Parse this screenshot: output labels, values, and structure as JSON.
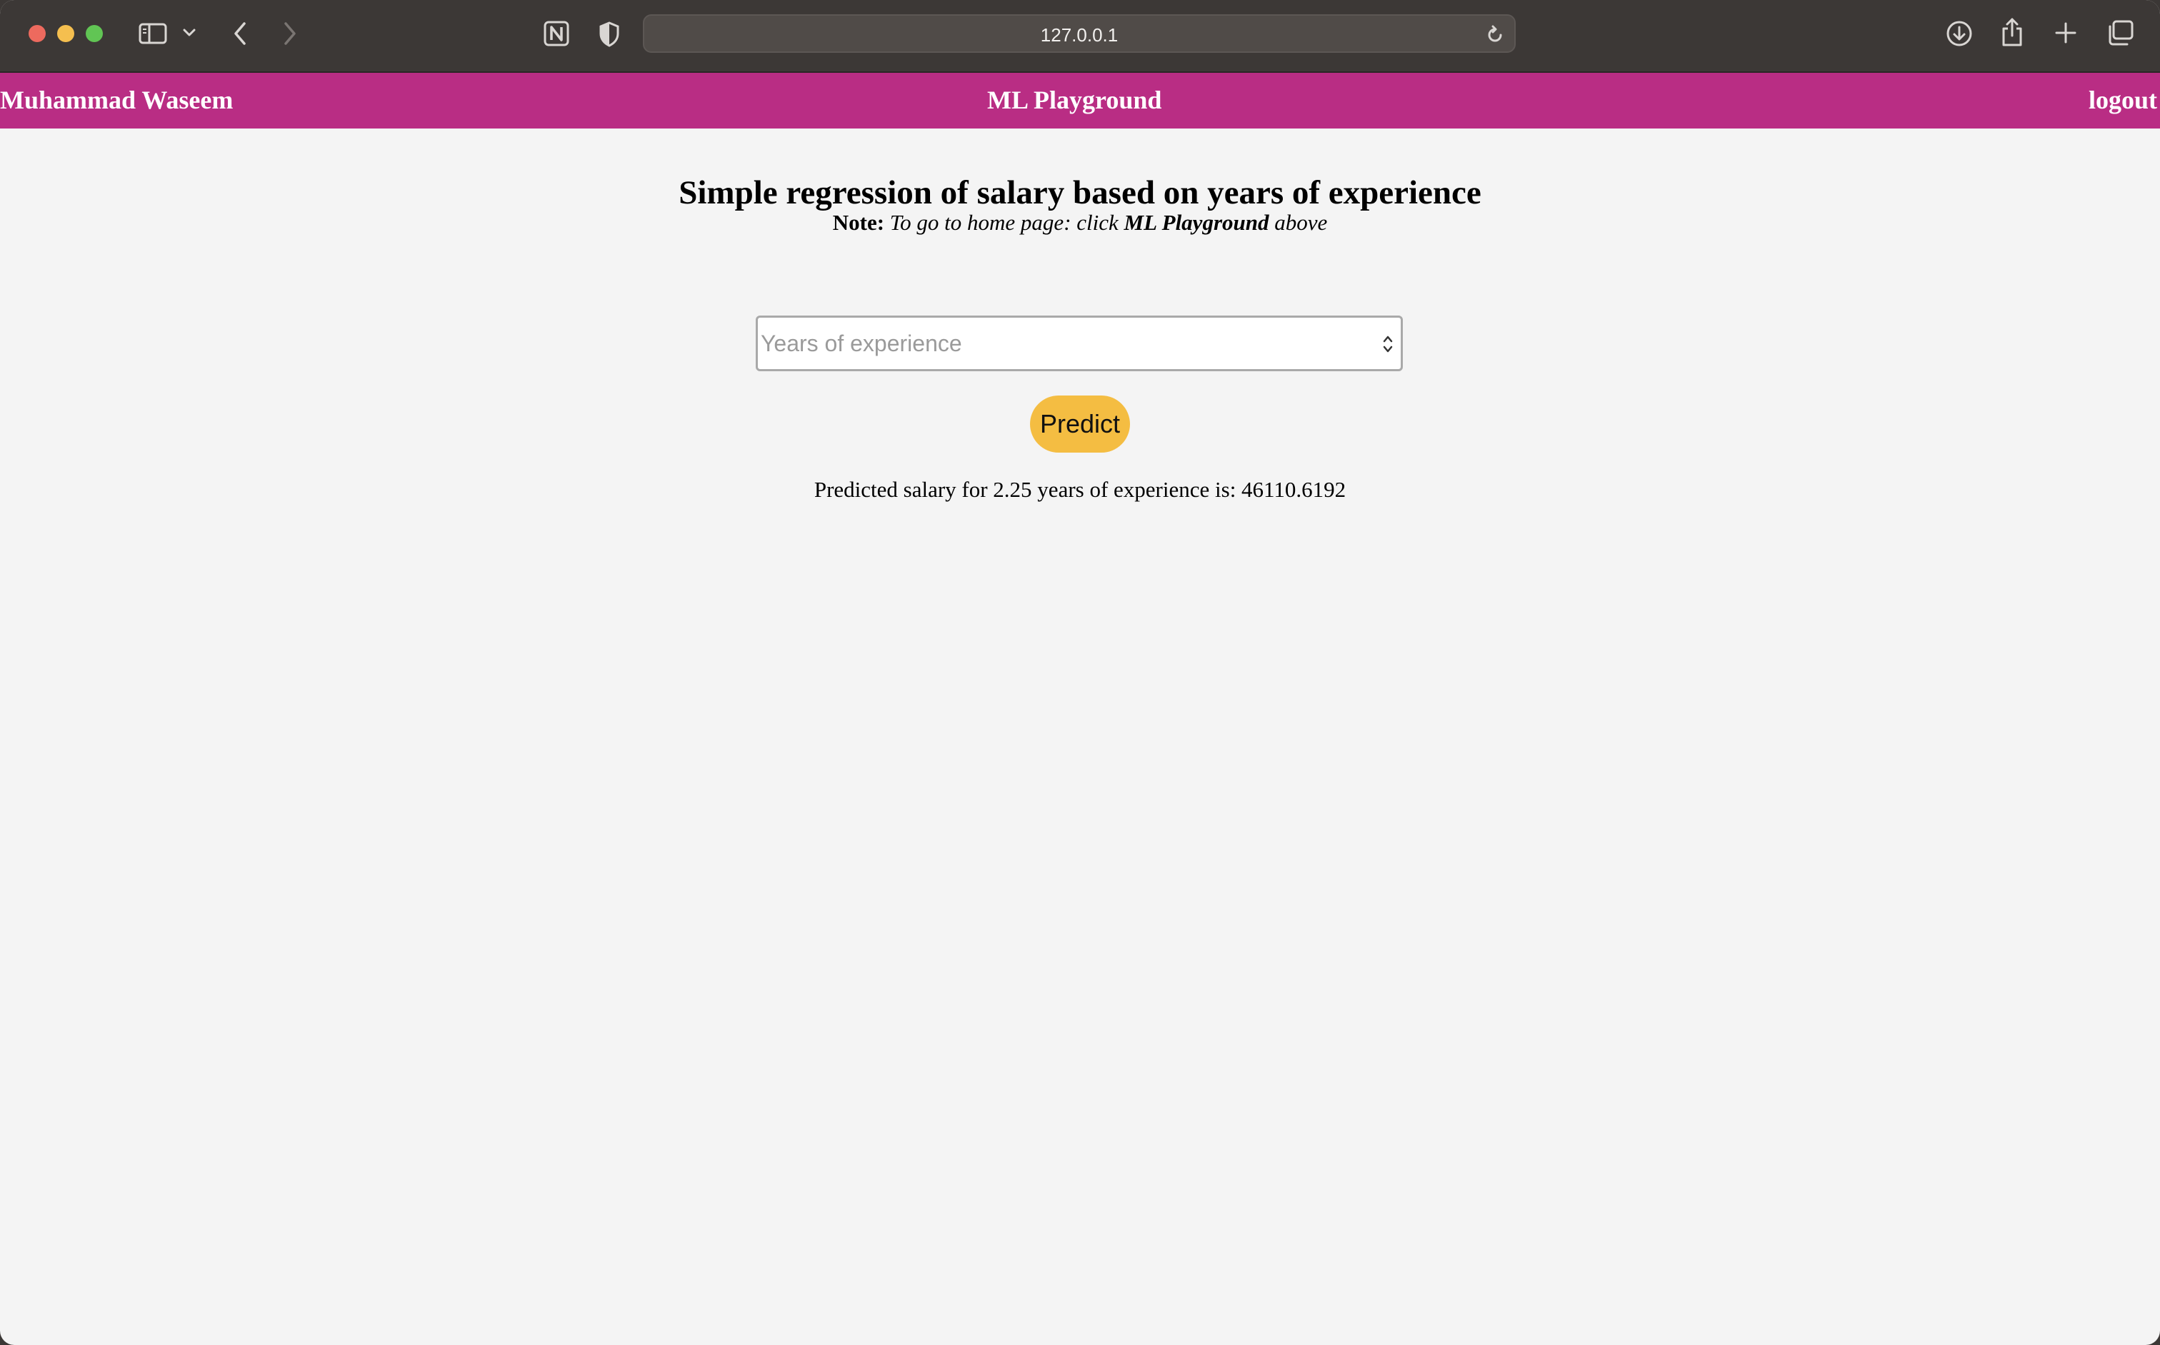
{
  "browser": {
    "url": "127.0.0.1",
    "icons": {
      "sidebar": "sidebar-icon",
      "sidebar_menu": "chevron-down-icon",
      "back": "chevron-left-icon",
      "forward": "chevron-right-icon",
      "notion": "notion-icon",
      "privacy": "shield-icon",
      "reload": "reload-icon",
      "downloads": "download-icon",
      "share": "share-icon",
      "new_tab": "plus-icon",
      "tabs": "tab-overview-icon"
    },
    "traffic_lights": {
      "close": "#ed6a5e",
      "minimize": "#f5bf4f",
      "zoom": "#61c554"
    }
  },
  "navbar": {
    "user_name": "Muhammad Waseem",
    "brand": "ML Playground",
    "logout": "logout",
    "color": "#b92d84"
  },
  "main": {
    "title": "Simple regression of salary based on years of experience",
    "note_label": "Note:",
    "note_text_pre": "To go to home page: click",
    "note_link": "ML Playground",
    "note_text_post": "above",
    "input_placeholder": "Years of experience",
    "input_value": "",
    "predict_label": "Predict",
    "predict_color": "#f4bd42",
    "result": "Predicted salary for 2.25 years of experience is: 46110.6192"
  }
}
